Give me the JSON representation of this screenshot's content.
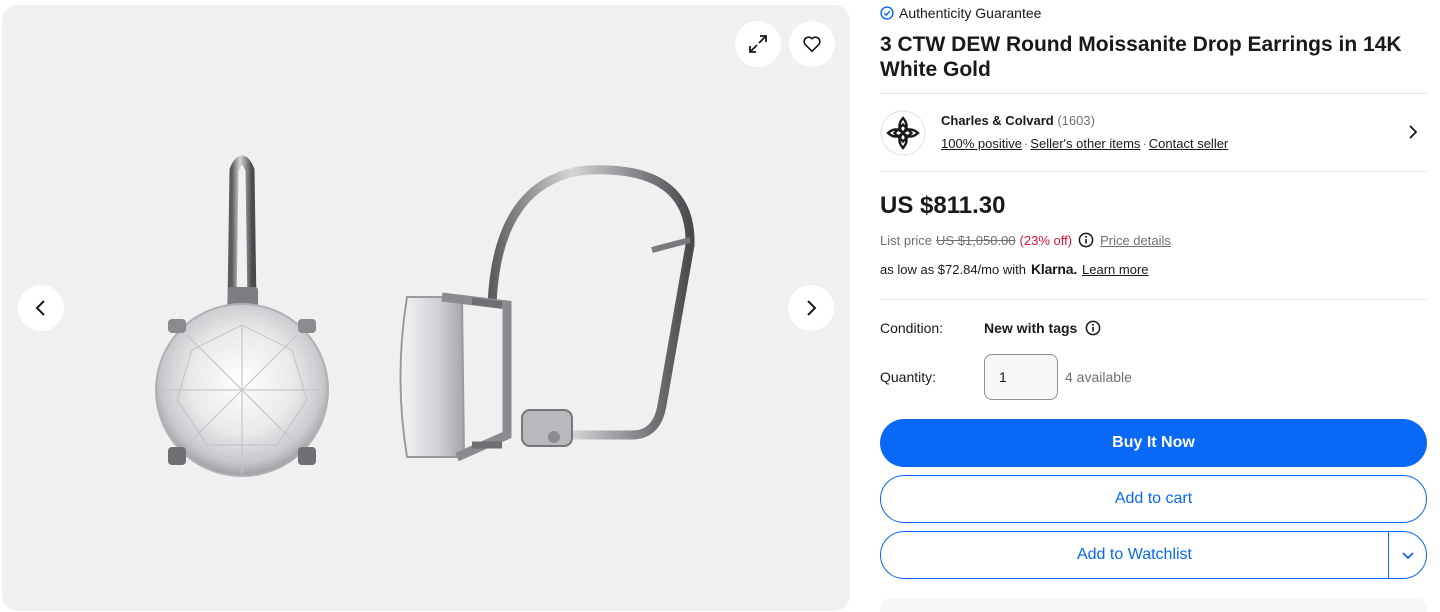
{
  "gallery": {
    "expand_icon": "expand-icon",
    "watch_icon": "heart-icon",
    "prev_icon": "chevron-left-icon",
    "next_icon": "chevron-right-icon"
  },
  "product": {
    "authenticity": "Authenticity Guarantee",
    "title": "3 CTW DEW Round Moissanite Drop Earrings in 14K White Gold"
  },
  "seller": {
    "name": "Charles & Colvard",
    "feedback_count": "(1603)",
    "positive": "100% positive",
    "other_items": "Seller's other items",
    "contact": "Contact seller"
  },
  "pricing": {
    "price": "US $811.30",
    "list_label": "List price",
    "list_price": "US $1,050.00",
    "discount": "(23% off)",
    "details_link": "Price details",
    "installment": "as low as $72.84/mo with",
    "klarna": "Klarna.",
    "learn_more": "Learn more"
  },
  "condition": {
    "label": "Condition:",
    "value": "New with tags"
  },
  "quantity": {
    "label": "Quantity:",
    "value": "1",
    "available": "4 available"
  },
  "actions": {
    "buy_now": "Buy It Now",
    "add_to_cart": "Add to cart",
    "add_to_watchlist": "Add to Watchlist"
  },
  "colors": {
    "primary": "#0968f6",
    "discount_red": "#e0103a",
    "muted_text": "#707070",
    "gallery_bg": "#f0f0f0"
  }
}
